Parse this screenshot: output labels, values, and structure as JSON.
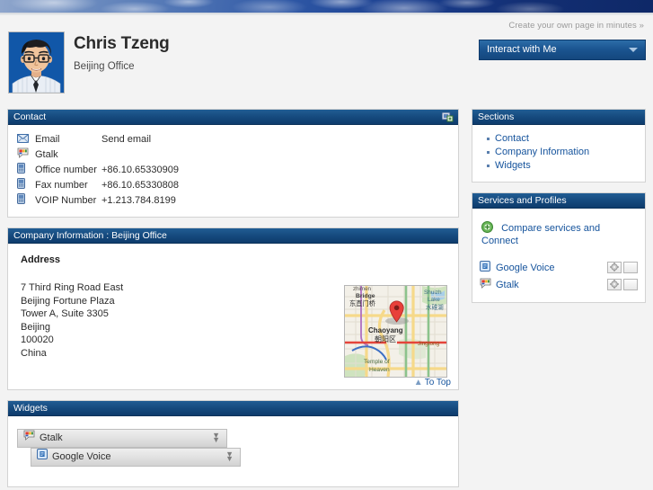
{
  "banner": {
    "alt": "sky-clouds-banner"
  },
  "header": {
    "tagline": "Create your own page in minutes »",
    "name": "Chris Tzeng",
    "office": "Beijing Office",
    "interact_label": "Interact with Me",
    "avatar_alt": "cartoon-portrait-man-with-glasses"
  },
  "contact": {
    "title": "Contact",
    "rows": [
      {
        "icon": "email-icon",
        "label": "Email",
        "value": "Send email",
        "is_link": true
      },
      {
        "icon": "gtalk-icon",
        "label": "Gtalk",
        "value": "",
        "is_link": false
      },
      {
        "icon": "phone-icon",
        "label": "Office number",
        "value": "+86.10.65330909",
        "is_link": false
      },
      {
        "icon": "phone-icon",
        "label": "Fax number",
        "value": "+86.10.65330808",
        "is_link": false
      },
      {
        "icon": "phone-icon",
        "label": "VOIP Number",
        "value": "+1.213.784.8199",
        "is_link": false
      }
    ]
  },
  "company": {
    "title": "Company Information : Beijing Office",
    "address_heading": "Address",
    "address_lines": [
      "7 Third Ring Road East",
      "Beijing Fortune Plaza",
      "Tower A, Suite 3305",
      "Beijing",
      "100020",
      "China"
    ],
    "to_top": "To Top",
    "map": {
      "alt": "beijing-chaoyang-map-thumbnail",
      "labels": [
        "Bridge",
        "东直门桥",
        "Shuizh",
        "Lake",
        "水碓湖",
        "Chaoyang",
        "朝阳区",
        "Jingtong",
        "Temple of",
        "Heaven"
      ]
    }
  },
  "widgets": {
    "title": "Widgets",
    "items": [
      {
        "icon": "gtalk-icon",
        "label": "Gtalk"
      },
      {
        "icon": "google-voice-icon",
        "label": "Google Voice"
      }
    ]
  },
  "sections": {
    "title": "Sections",
    "items": [
      {
        "label": "Contact"
      },
      {
        "label": "Company Information"
      },
      {
        "label": "Widgets"
      }
    ]
  },
  "services": {
    "title": "Services and Profiles",
    "compare_label": "Compare services and Connect",
    "rows": [
      {
        "icon": "google-voice-icon",
        "label": "Google Voice"
      },
      {
        "icon": "gtalk-icon",
        "label": "Gtalk"
      }
    ]
  },
  "colors": {
    "panel_header_blue": "#164a7e",
    "link_blue": "#15539c",
    "page_background": "#f3f3f3",
    "banner_dark_blue": "#0e2867",
    "accent_green": "#3d9b3d"
  }
}
